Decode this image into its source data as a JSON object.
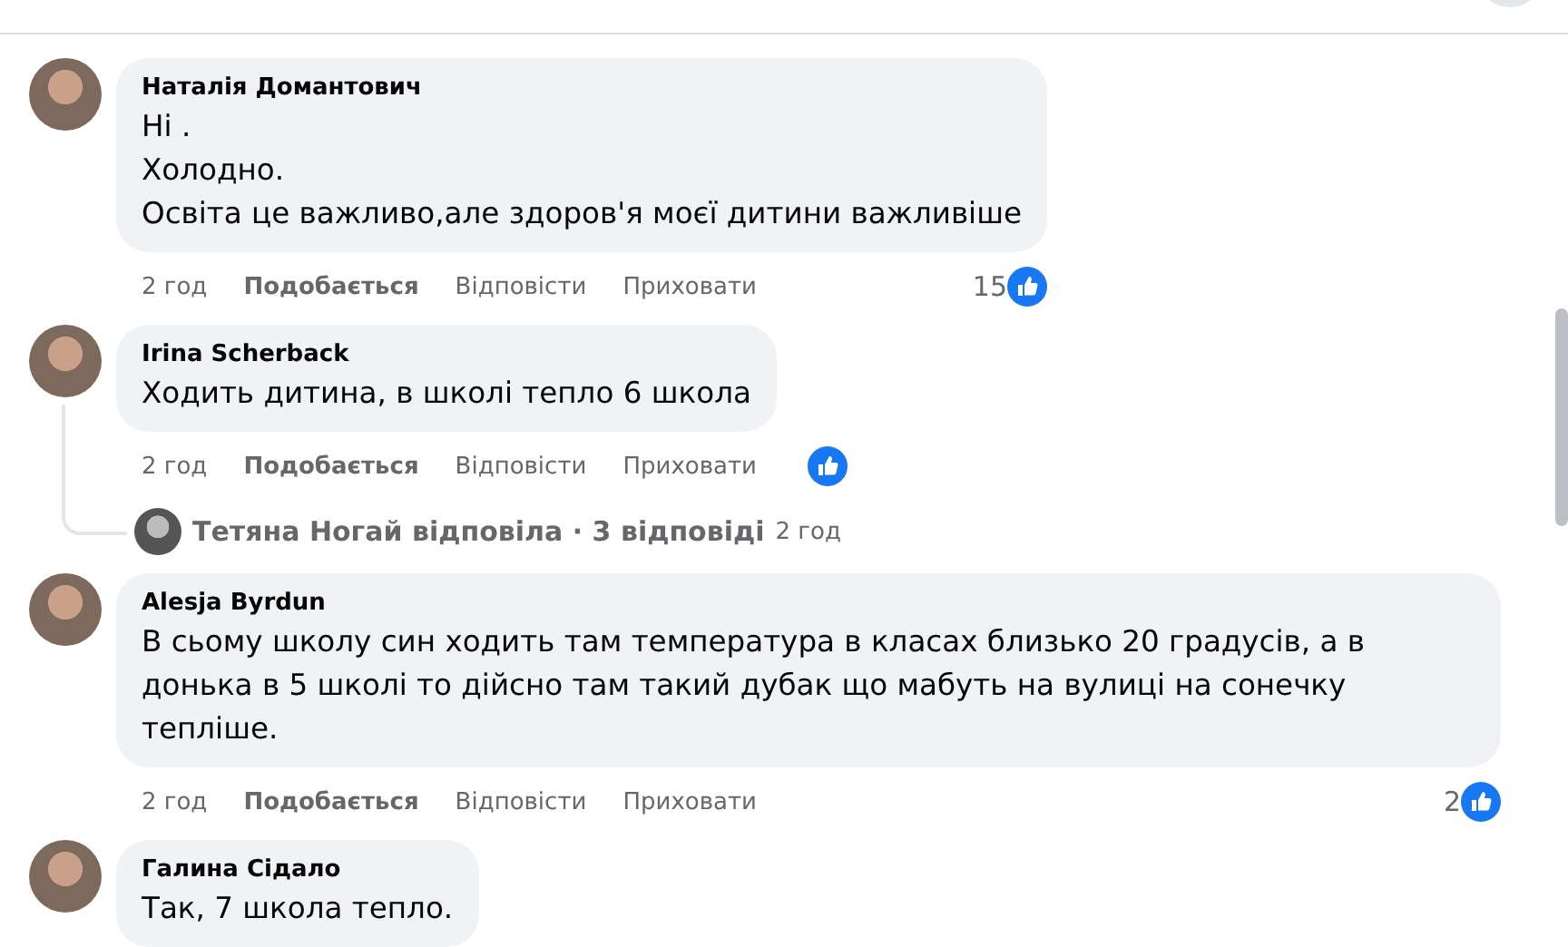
{
  "comments": [
    {
      "author": "Наталія Домантович",
      "lines": [
        "Ні .",
        "Холодно.",
        "Освіта це важливо,але здоров'я моєї дитини важливіше"
      ],
      "time": "2 год",
      "actions": [
        "Подобається",
        "Відповісти",
        "Приховати"
      ],
      "reaction_count": "15",
      "has_reactions": true
    },
    {
      "author": "Irina Scherback",
      "lines": [
        "Ходить дитина, в школі тепло 6 школа"
      ],
      "time": "2 год",
      "actions": [
        "Подобається",
        "Відповісти",
        "Приховати"
      ],
      "has_reactions": true,
      "replies": {
        "text": "Тетяна Ногай відповіла · 3 відповіді",
        "time": "2 год"
      }
    },
    {
      "author": "Alesja Byrdun",
      "lines": [
        "В сьому школу син ходить там температура в класах близько 20 градусів, а в донька в 5 школі то дійсно там такий дубак що мабуть на вулиці на сонечку тепліше."
      ],
      "time": "2 год",
      "actions": [
        "Подобається",
        "Відповісти",
        "Приховати"
      ],
      "reaction_count": "2",
      "has_reactions": true
    },
    {
      "author": "Галина Сідало",
      "lines": [
        "Так, 7 школа тепло."
      ]
    }
  ]
}
